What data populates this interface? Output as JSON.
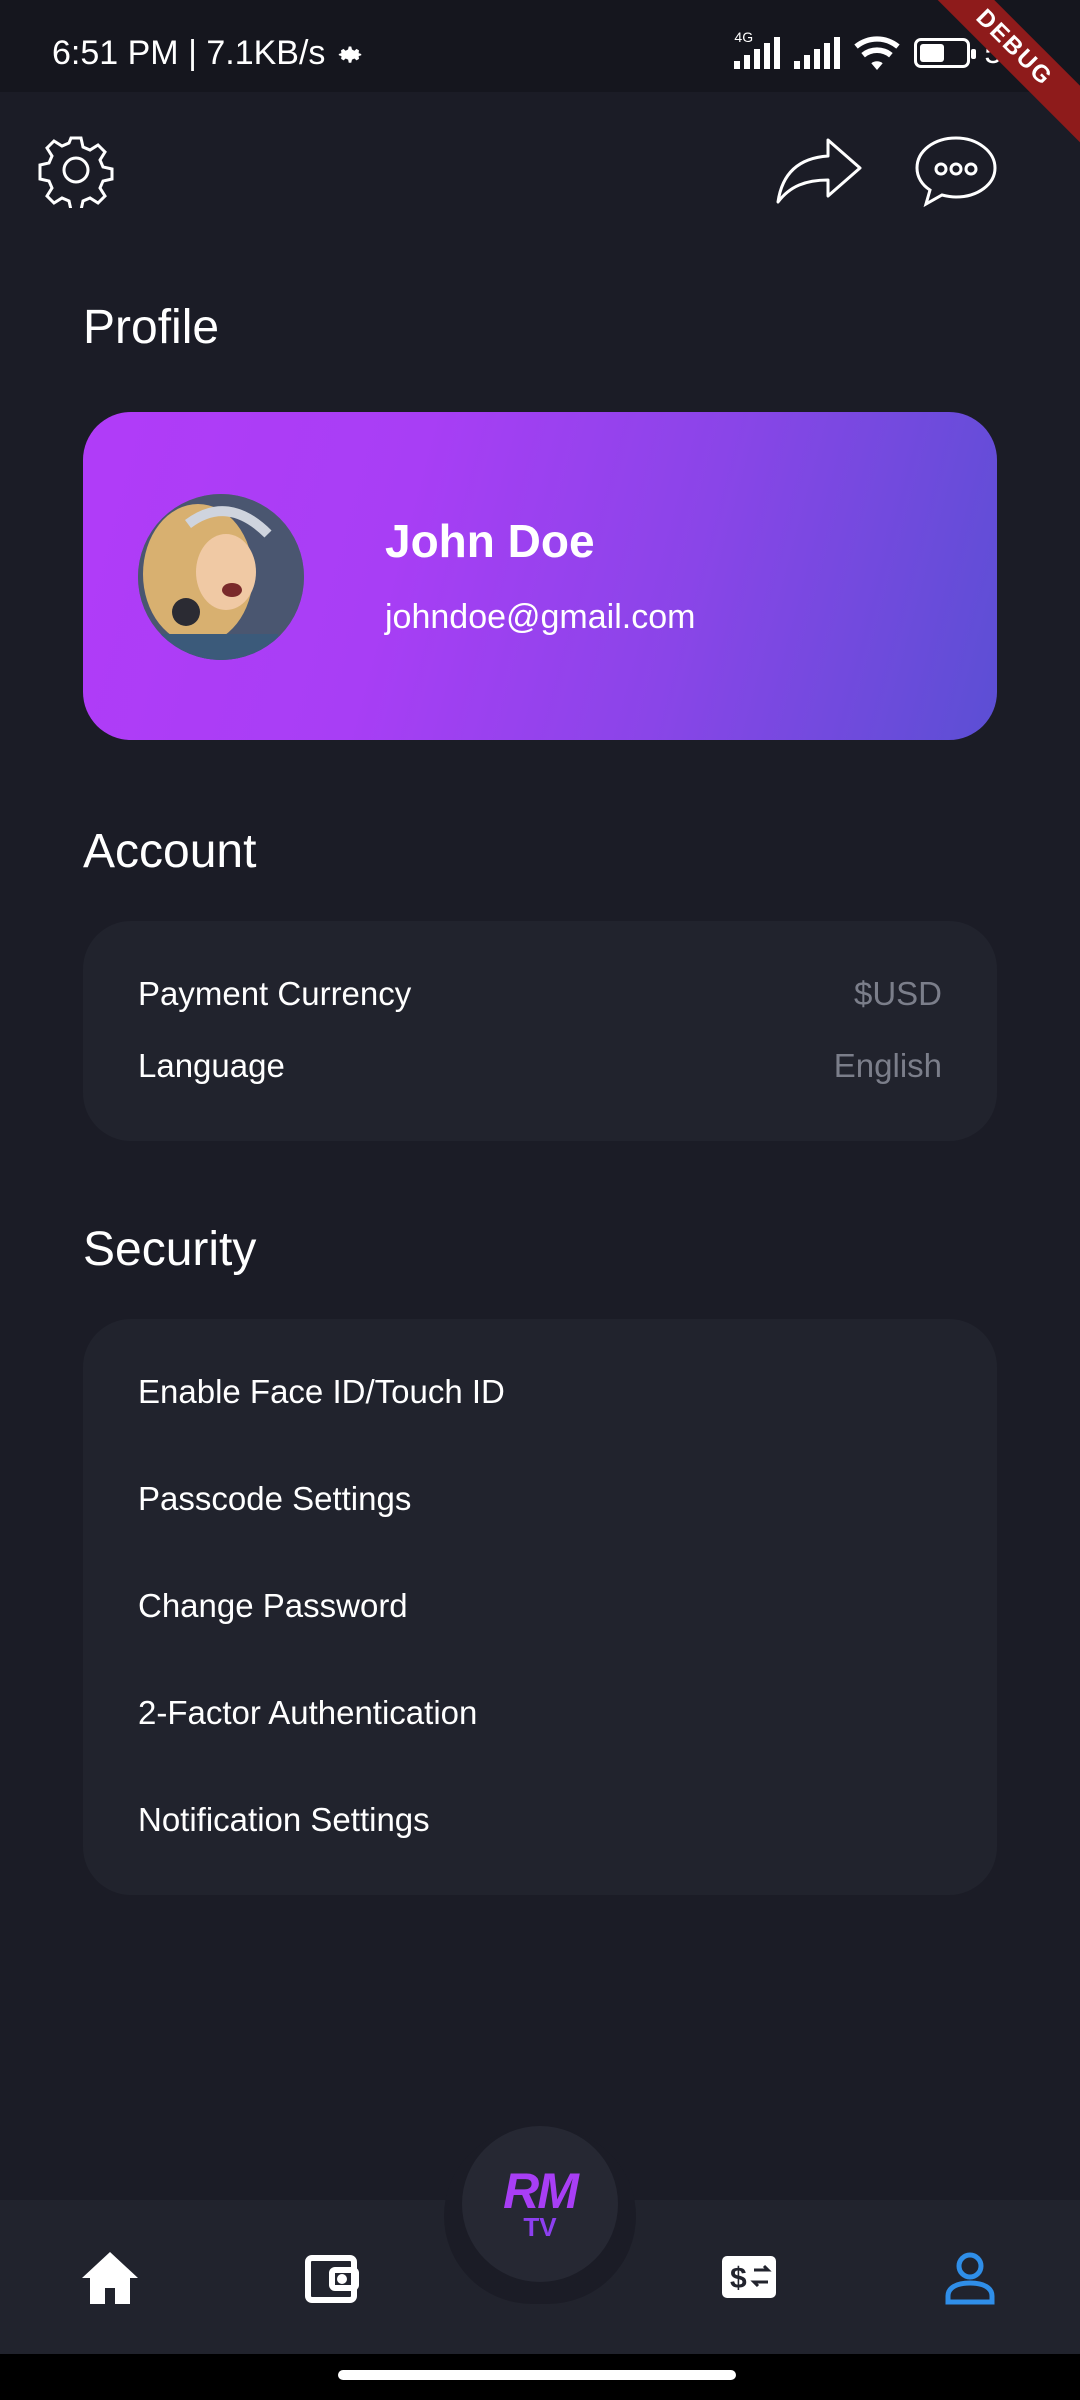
{
  "status_bar": {
    "time_speed": "6:51 PM | 7.1KB/s",
    "network_label": "4G",
    "battery": "52"
  },
  "debug_banner": "DEBUG",
  "top_bar": {
    "icons": [
      "gear-icon",
      "share-icon",
      "chat-icon"
    ]
  },
  "profile": {
    "title": "Profile",
    "name": "John Doe",
    "email": "johndoe@gmail.com"
  },
  "account": {
    "title": "Account",
    "items": [
      {
        "label": "Payment Currency",
        "value": "$USD"
      },
      {
        "label": "Language",
        "value": "English"
      }
    ]
  },
  "security": {
    "title": "Security",
    "items": [
      {
        "label": "Enable Face ID/Touch ID"
      },
      {
        "label": "Passcode Settings"
      },
      {
        "label": "Change Password"
      },
      {
        "label": "2-Factor Authentication"
      },
      {
        "label": "Notification Settings"
      }
    ]
  },
  "bottom_nav": {
    "logo_top": "RM",
    "logo_bottom": "TV",
    "items": [
      "home-icon",
      "wallet-icon",
      "exchange-icon",
      "profile-icon"
    ],
    "active_color": "#2f8ee8"
  },
  "colors": {
    "background": "#1b1c26",
    "card": "#21232d",
    "accent_purple": "#a83ef5",
    "muted_text": "#7b7e8a"
  }
}
